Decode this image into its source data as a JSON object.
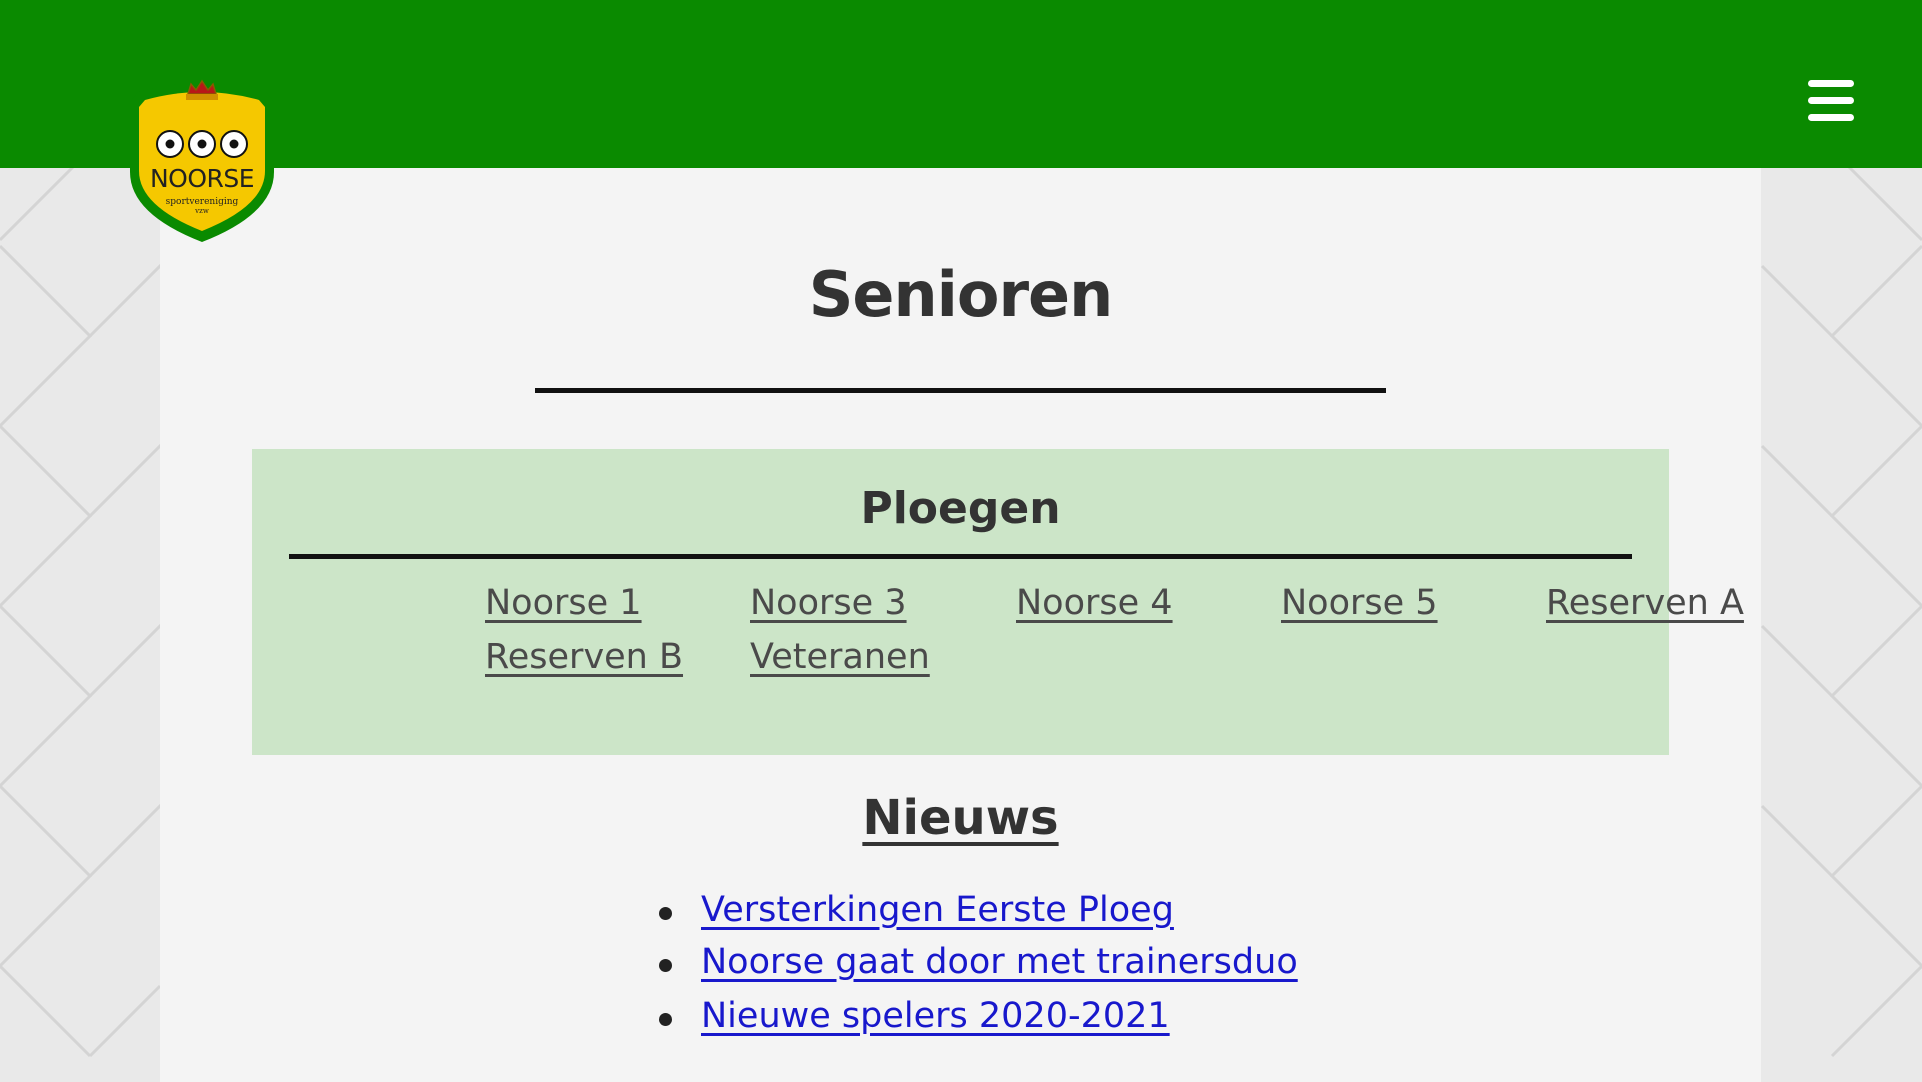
{
  "club": {
    "logo_name": "NOORSE",
    "logo_sub1": "sportvereniging",
    "logo_sub2": "vzw"
  },
  "colors": {
    "header_green": "#0a8a00",
    "panel_green": "#cce5c8",
    "link_blue": "#1818cc",
    "logo_yellow": "#f5c800"
  },
  "header": {
    "menu_icon": "hamburger-menu-icon"
  },
  "page": {
    "title": "Senioren"
  },
  "teams": {
    "title": "Ploegen",
    "links": [
      "Noorse 1",
      "Noorse 3",
      "Noorse 4",
      "Noorse 5",
      "Reserven A",
      "Reserven B",
      "Veteranen"
    ]
  },
  "news": {
    "title": "Nieuws",
    "items": [
      "Versterkingen Eerste Ploeg",
      "Noorse gaat door met trainersduo",
      "Nieuwe spelers 2020-2021"
    ]
  }
}
